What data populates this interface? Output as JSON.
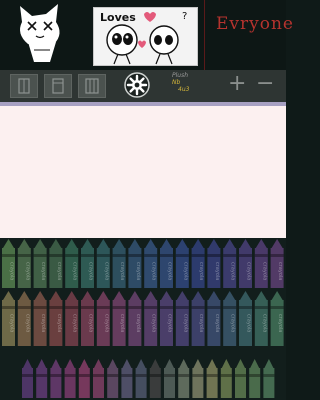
{
  "header": {
    "sticker_title": "Loves",
    "sticker_mark": "?",
    "banner_text": "Evryone"
  },
  "toolbar": {
    "tool_icons": [
      "eraser-icon",
      "page-icon",
      "layers-icon"
    ],
    "settings_icon": "gear-icon",
    "signature_lines": [
      "Plush",
      "Nb",
      "4u3"
    ],
    "zoom_in_label": "+",
    "zoom_out_label": "−"
  },
  "canvas": {
    "background": "#fcf0f0"
  },
  "crayons": {
    "wrapper_text": "crayola",
    "rows": [
      {
        "colors": [
          "#4a7046",
          "#466447",
          "#406046",
          "#3a5a44",
          "#2f5c4b",
          "#2e5a53",
          "#2d5659",
          "#2d4f5e",
          "#2e4b66",
          "#2f4a6e",
          "#2e466e",
          "#2c4170",
          "#2c3b6d",
          "#313a6c",
          "#3a3b6c",
          "#413a6a",
          "#4a3968",
          "#523a66"
        ]
      },
      {
        "colors": [
          "#6e6a48",
          "#6d5a42",
          "#6b4a40",
          "#6a3f3f",
          "#683a44",
          "#6a3a4d",
          "#6a3b56",
          "#653c5e",
          "#5c3d62",
          "#543d66",
          "#4a3e69",
          "#433e6a",
          "#3c4069",
          "#374867",
          "#355062",
          "#34585c",
          "#365f56",
          "#3b6650"
        ]
      },
      {
        "colors": [
          "#4d3566",
          "#553668",
          "#5e3766",
          "#6a3660",
          "#76385c",
          "#6f3a5a",
          "#5a4660",
          "#4e4e66",
          "#454e60",
          "#3a3c3c",
          "#4d5a55",
          "#5e6a5c",
          "#6e735c",
          "#707452",
          "#5f7048",
          "#526d48",
          "#4a6b4b",
          "#446a50"
        ]
      }
    ]
  }
}
